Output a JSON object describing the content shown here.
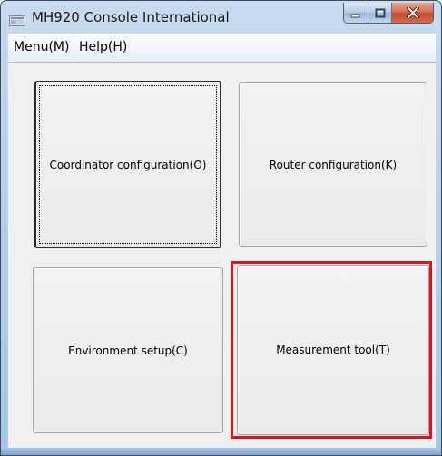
{
  "window": {
    "title": "MH920 Console International",
    "icon": "app-window-icon"
  },
  "controls": {
    "minimize": "minimize-icon",
    "maximize": "maximize-icon",
    "close": "close-icon"
  },
  "menubar": {
    "items": [
      {
        "label": "Menu(M)"
      },
      {
        "label": "Help(H)"
      }
    ]
  },
  "buttons": {
    "coordinator": "Coordinator configuration(O)",
    "router": "Router configuration(K)",
    "environment": "Environment setup(C)",
    "measurement": "Measurement tool(T)"
  },
  "colors": {
    "highlight": "#e0101c",
    "close_button": "#c24a2e"
  }
}
